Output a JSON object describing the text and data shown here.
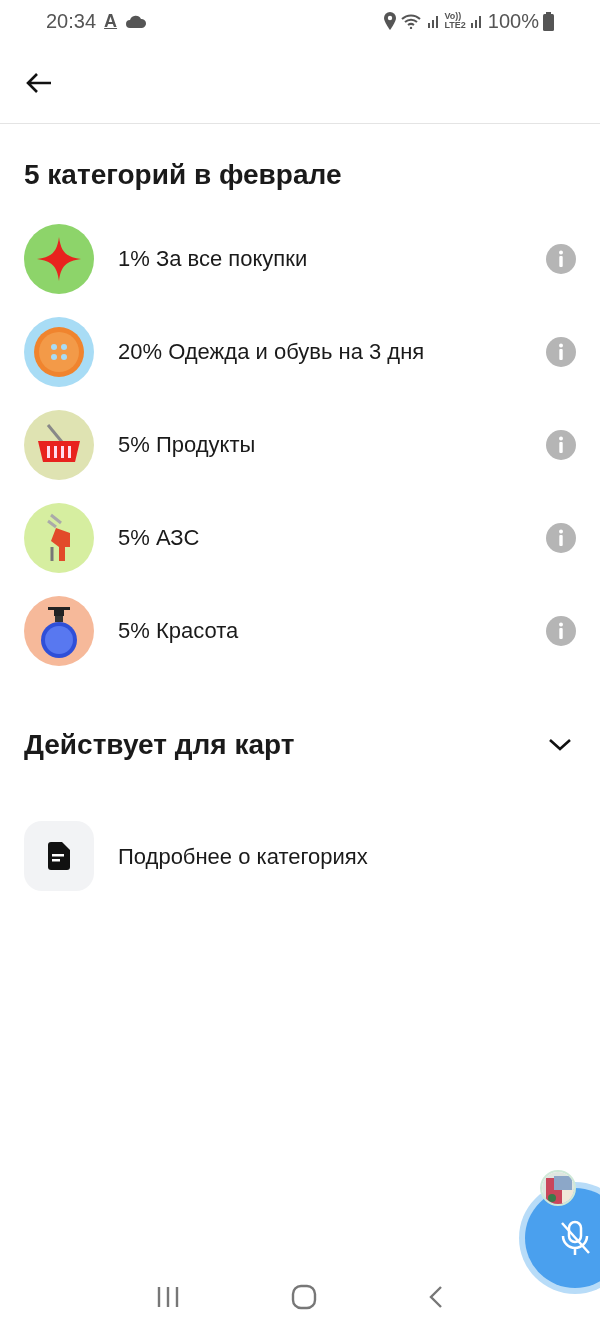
{
  "status_bar": {
    "time": "20:34",
    "notification_glyph": "A",
    "volte_label": "Vo))",
    "lte_label": "LTE2",
    "battery": "100%"
  },
  "title": "5 категорий в феврале",
  "categories": [
    {
      "kind": "star",
      "color": "#8dd46a",
      "label": "1% За все покупки"
    },
    {
      "kind": "button",
      "color": "#a8dcf5",
      "label": "20% Одежда и обувь на 3 дня"
    },
    {
      "kind": "basket",
      "color": "#dfe3b2",
      "label": "5% Продукты"
    },
    {
      "kind": "pump",
      "color": "#d6eea0",
      "label": "5% АЗС"
    },
    {
      "kind": "bottle",
      "color": "#f6b99a",
      "label": "5% Красота"
    }
  ],
  "cards_section": {
    "title": "Действует для карт",
    "expanded": false
  },
  "details_link": {
    "label": "Подробнее о категориях"
  }
}
